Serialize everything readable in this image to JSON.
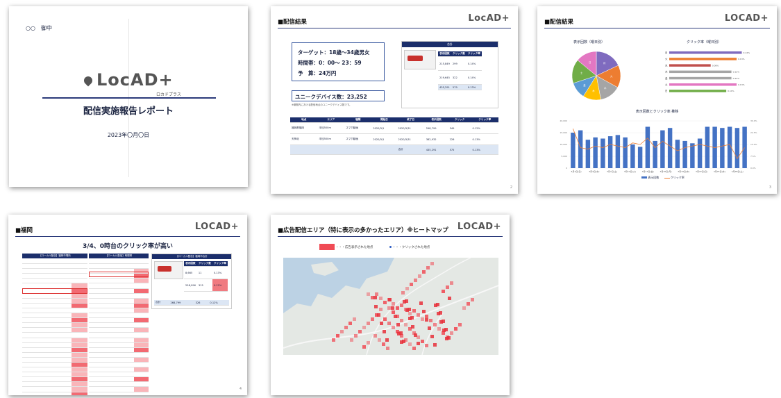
{
  "colors": {
    "navy": "#1b2e6b",
    "bar": "#4472c4",
    "line": "#ed7d31",
    "heat": "#f04b55",
    "map": "#dfe3e6"
  },
  "slide1": {
    "recipient": "○○　御中",
    "logo": "LocAD+",
    "logo_kana": "ロカドプラス",
    "title": "配信実施報告レポート",
    "date": "2023年〇月〇日"
  },
  "slide2": {
    "heading": "■配信結果",
    "logo": "LocAD+",
    "target": "ターゲット：18歳～34歳男女",
    "time": "時間帯：0：00～ 23：59",
    "budget": "予　算：24万円",
    "unique": "ユニークデバイス数：23,252",
    "unique_note": "※期間内における配信地点のユニークデバイス数です。",
    "mini_title": "合計",
    "mini_headers": [
      "表示回数",
      "クリック数",
      "クリック率"
    ],
    "mini_rows": [
      [
        "215,849",
        "299",
        "0.14%"
      ],
      [
        "219,645",
        "322",
        "0.14%"
      ]
    ],
    "mini_total": [
      "435,291",
      "579",
      "0.13%"
    ],
    "table_headers": [
      "地点",
      "エリア",
      "種類",
      "開始日",
      "終了日",
      "表示回数",
      "クリック",
      "クリック率"
    ],
    "table_rows": [
      [
        "福岡県福岡",
        "半径500m",
        "スマホ動画",
        "2020/3/1",
        "2020/3/31",
        "298,799",
        "349",
        "0.12%"
      ],
      [
        "天神北",
        "半径500m",
        "スマホ動画",
        "2020/3/1",
        "2020/3/31",
        "382,932",
        "226",
        "0.13%"
      ]
    ],
    "table_total": [
      "合計",
      "435,291",
      "575",
      "0.13%"
    ],
    "page": "2"
  },
  "slide3": {
    "heading": "■配信結果",
    "logo": "LOCAD+",
    "pie_title": "表示回数（曜日別）",
    "bar_title": "クリック率（曜日別）",
    "combo_title": "表示回数とクリック率 推移",
    "legend": [
      "表示回数",
      "クリック率"
    ],
    "page": "3"
  },
  "slide4": {
    "heading": "■福岡",
    "logo": "LOCAD+",
    "headline": "3/4、0時台のクリック率が高い",
    "t1_title": "【ローカル配信】福岡市場所",
    "t2_title": "【ローカル配信】時間帯",
    "t3_title": "【ローカル配信】福岡市合計",
    "t3_headers": [
      "表示回数",
      "クリック数",
      "クリック率"
    ],
    "t3_rows": [
      [
        "8,665",
        "11",
        "0.13%"
      ],
      [
        "258,996",
        "315",
        "0.12%"
      ]
    ],
    "t3_total": [
      "合計",
      "268,799",
      "326",
      "0.12%"
    ],
    "page": "4"
  },
  "slide5": {
    "heading": "■広告配信エリア（特に表示の多かったエリア）※ヒートマップ",
    "logo": "LOCAD+",
    "legend_heat": "・・・広告表示された地点",
    "legend_click": "・・・クリックされた地点"
  },
  "chart_data": [
    {
      "type": "pie",
      "title": "表示回数（曜日別）",
      "categories": [
        "月",
        "火",
        "水",
        "木",
        "金",
        "土",
        "日"
      ],
      "values": [
        18,
        15,
        14,
        12,
        11,
        16,
        14
      ]
    },
    {
      "type": "bar",
      "title": "クリック率（曜日別）",
      "categories": [
        "月",
        "火",
        "水",
        "木",
        "金",
        "土",
        "日"
      ],
      "values": [
        0.14,
        0.13,
        0.08,
        0.12,
        0.12,
        0.13,
        0.11
      ],
      "unit": "%"
    },
    {
      "type": "bar",
      "title": "表示回数とクリック率 推移",
      "series": [
        {
          "name": "表示回数",
          "values": [
            15000,
            16000,
            12000,
            13000,
            12500,
            13500,
            14000,
            13000,
            10000,
            9000,
            17500,
            11500,
            16000,
            17000,
            12000,
            11500,
            10500,
            12500,
            17500,
            17500,
            17000,
            17500,
            17000,
            17500
          ]
        },
        {
          "name": "クリック率",
          "values": [
            0.25,
            0.13,
            0.12,
            0.14,
            0.13,
            0.15,
            0.14,
            0.13,
            0.16,
            0.15,
            0.19,
            0.13,
            0.17,
            0.14,
            0.11,
            0.13,
            0.14,
            0.15,
            0.14,
            0.13,
            0.14,
            0.15,
            0.06,
            0.13
          ]
        }
      ],
      "ylim": [
        0,
        20000
      ],
      "y2lim": [
        0,
        0.3
      ],
      "xlabels": [
        "3月1日(日)",
        "3月4日(水)",
        "3月7日(土)",
        "3月10日(火)",
        "3月13日(金)",
        "3月16日(月)",
        "3月19日(木)",
        "3月22日(日)",
        "3月25日(水)",
        "3月28日(土)"
      ]
    }
  ]
}
